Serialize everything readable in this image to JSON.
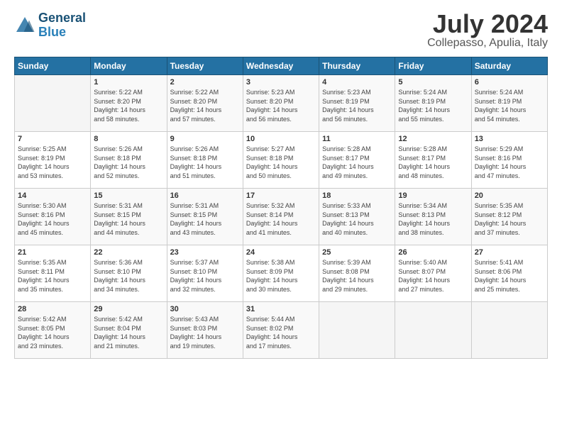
{
  "header": {
    "logo_line1": "General",
    "logo_line2": "Blue",
    "month": "July 2024",
    "location": "Collepasso, Apulia, Italy"
  },
  "days_of_week": [
    "Sunday",
    "Monday",
    "Tuesday",
    "Wednesday",
    "Thursday",
    "Friday",
    "Saturday"
  ],
  "weeks": [
    [
      {
        "day": "",
        "info": ""
      },
      {
        "day": "1",
        "info": "Sunrise: 5:22 AM\nSunset: 8:20 PM\nDaylight: 14 hours\nand 58 minutes."
      },
      {
        "day": "2",
        "info": "Sunrise: 5:22 AM\nSunset: 8:20 PM\nDaylight: 14 hours\nand 57 minutes."
      },
      {
        "day": "3",
        "info": "Sunrise: 5:23 AM\nSunset: 8:20 PM\nDaylight: 14 hours\nand 56 minutes."
      },
      {
        "day": "4",
        "info": "Sunrise: 5:23 AM\nSunset: 8:19 PM\nDaylight: 14 hours\nand 56 minutes."
      },
      {
        "day": "5",
        "info": "Sunrise: 5:24 AM\nSunset: 8:19 PM\nDaylight: 14 hours\nand 55 minutes."
      },
      {
        "day": "6",
        "info": "Sunrise: 5:24 AM\nSunset: 8:19 PM\nDaylight: 14 hours\nand 54 minutes."
      }
    ],
    [
      {
        "day": "7",
        "info": "Sunrise: 5:25 AM\nSunset: 8:19 PM\nDaylight: 14 hours\nand 53 minutes."
      },
      {
        "day": "8",
        "info": "Sunrise: 5:26 AM\nSunset: 8:18 PM\nDaylight: 14 hours\nand 52 minutes."
      },
      {
        "day": "9",
        "info": "Sunrise: 5:26 AM\nSunset: 8:18 PM\nDaylight: 14 hours\nand 51 minutes."
      },
      {
        "day": "10",
        "info": "Sunrise: 5:27 AM\nSunset: 8:18 PM\nDaylight: 14 hours\nand 50 minutes."
      },
      {
        "day": "11",
        "info": "Sunrise: 5:28 AM\nSunset: 8:17 PM\nDaylight: 14 hours\nand 49 minutes."
      },
      {
        "day": "12",
        "info": "Sunrise: 5:28 AM\nSunset: 8:17 PM\nDaylight: 14 hours\nand 48 minutes."
      },
      {
        "day": "13",
        "info": "Sunrise: 5:29 AM\nSunset: 8:16 PM\nDaylight: 14 hours\nand 47 minutes."
      }
    ],
    [
      {
        "day": "14",
        "info": "Sunrise: 5:30 AM\nSunset: 8:16 PM\nDaylight: 14 hours\nand 45 minutes."
      },
      {
        "day": "15",
        "info": "Sunrise: 5:31 AM\nSunset: 8:15 PM\nDaylight: 14 hours\nand 44 minutes."
      },
      {
        "day": "16",
        "info": "Sunrise: 5:31 AM\nSunset: 8:15 PM\nDaylight: 14 hours\nand 43 minutes."
      },
      {
        "day": "17",
        "info": "Sunrise: 5:32 AM\nSunset: 8:14 PM\nDaylight: 14 hours\nand 41 minutes."
      },
      {
        "day": "18",
        "info": "Sunrise: 5:33 AM\nSunset: 8:13 PM\nDaylight: 14 hours\nand 40 minutes."
      },
      {
        "day": "19",
        "info": "Sunrise: 5:34 AM\nSunset: 8:13 PM\nDaylight: 14 hours\nand 38 minutes."
      },
      {
        "day": "20",
        "info": "Sunrise: 5:35 AM\nSunset: 8:12 PM\nDaylight: 14 hours\nand 37 minutes."
      }
    ],
    [
      {
        "day": "21",
        "info": "Sunrise: 5:35 AM\nSunset: 8:11 PM\nDaylight: 14 hours\nand 35 minutes."
      },
      {
        "day": "22",
        "info": "Sunrise: 5:36 AM\nSunset: 8:10 PM\nDaylight: 14 hours\nand 34 minutes."
      },
      {
        "day": "23",
        "info": "Sunrise: 5:37 AM\nSunset: 8:10 PM\nDaylight: 14 hours\nand 32 minutes."
      },
      {
        "day": "24",
        "info": "Sunrise: 5:38 AM\nSunset: 8:09 PM\nDaylight: 14 hours\nand 30 minutes."
      },
      {
        "day": "25",
        "info": "Sunrise: 5:39 AM\nSunset: 8:08 PM\nDaylight: 14 hours\nand 29 minutes."
      },
      {
        "day": "26",
        "info": "Sunrise: 5:40 AM\nSunset: 8:07 PM\nDaylight: 14 hours\nand 27 minutes."
      },
      {
        "day": "27",
        "info": "Sunrise: 5:41 AM\nSunset: 8:06 PM\nDaylight: 14 hours\nand 25 minutes."
      }
    ],
    [
      {
        "day": "28",
        "info": "Sunrise: 5:42 AM\nSunset: 8:05 PM\nDaylight: 14 hours\nand 23 minutes."
      },
      {
        "day": "29",
        "info": "Sunrise: 5:42 AM\nSunset: 8:04 PM\nDaylight: 14 hours\nand 21 minutes."
      },
      {
        "day": "30",
        "info": "Sunrise: 5:43 AM\nSunset: 8:03 PM\nDaylight: 14 hours\nand 19 minutes."
      },
      {
        "day": "31",
        "info": "Sunrise: 5:44 AM\nSunset: 8:02 PM\nDaylight: 14 hours\nand 17 minutes."
      },
      {
        "day": "",
        "info": ""
      },
      {
        "day": "",
        "info": ""
      },
      {
        "day": "",
        "info": ""
      }
    ]
  ]
}
